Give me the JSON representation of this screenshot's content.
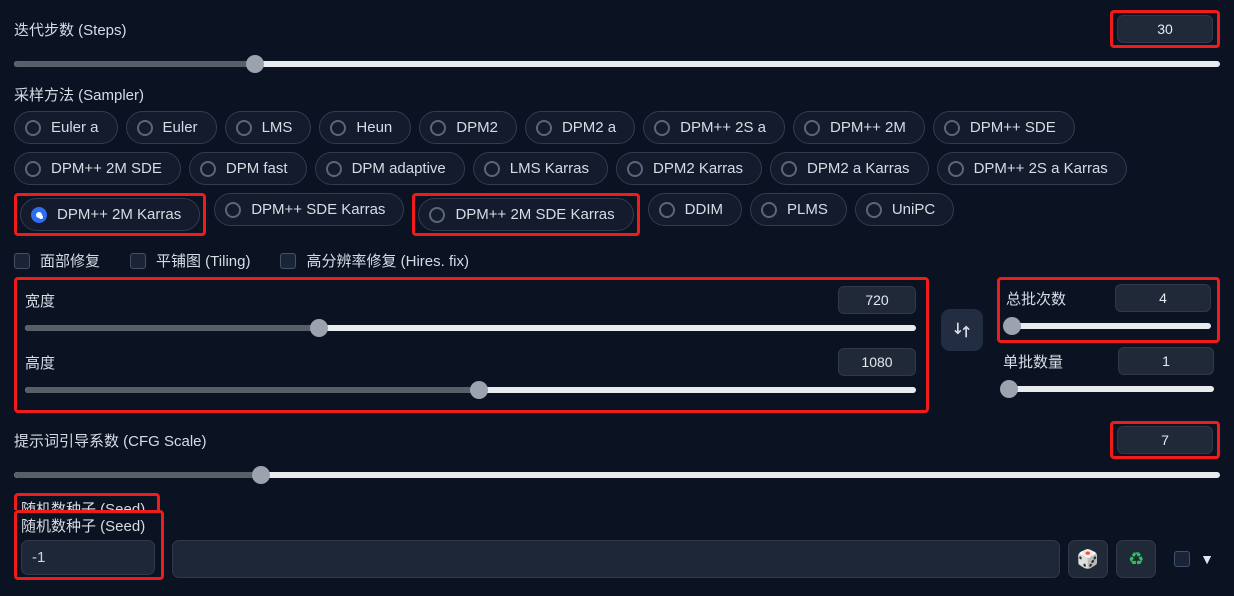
{
  "steps": {
    "label": "迭代步数 (Steps)",
    "value": "30",
    "percent": 20
  },
  "sampler": {
    "label": "采样方法 (Sampler)",
    "selected": "DPM++ 2M Karras",
    "options": [
      "Euler a",
      "Euler",
      "LMS",
      "Heun",
      "DPM2",
      "DPM2 a",
      "DPM++ 2S a",
      "DPM++ 2M",
      "DPM++ SDE",
      "DPM++ 2M SDE",
      "DPM fast",
      "DPM adaptive",
      "LMS Karras",
      "DPM2 Karras",
      "DPM2 a Karras",
      "DPM++ 2S a Karras",
      "DPM++ 2M Karras",
      "DPM++ SDE Karras",
      "DPM++ 2M SDE Karras",
      "DDIM",
      "PLMS",
      "UniPC"
    ]
  },
  "checks": {
    "face": "面部修复",
    "tiling": "平铺图 (Tiling)",
    "hires": "高分辨率修复 (Hires. fix)"
  },
  "width": {
    "label": "宽度",
    "value": "720",
    "percent": 33
  },
  "height": {
    "label": "高度",
    "value": "1080",
    "percent": 51
  },
  "batch_count": {
    "label": "总批次数",
    "value": "4",
    "percent": 3
  },
  "batch_size": {
    "label": "单批数量",
    "value": "1",
    "percent": 3
  },
  "cfg": {
    "label": "提示词引导系数 (CFG Scale)",
    "value": "7",
    "percent": 20.5
  },
  "seed": {
    "label": "随机数种子 (Seed)",
    "value": "-1"
  },
  "icons": {
    "dice": "🎲",
    "recycle": "♻",
    "tri": "▼"
  },
  "highlight_boxes": [
    "steps_value",
    "sampler_dpmpp2mkarras",
    "sampler_dpmpp2msdekarras",
    "dimensions_block",
    "batch_count_block",
    "cfg_value",
    "seed_label_block"
  ]
}
